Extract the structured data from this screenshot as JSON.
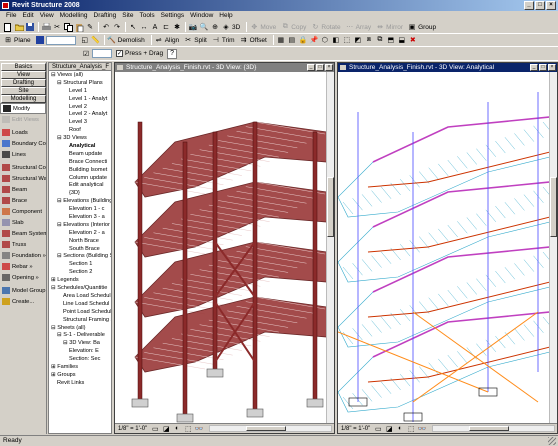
{
  "app": {
    "title": "Revit Structure 2008",
    "window_controls": [
      "_",
      "□",
      "×"
    ]
  },
  "menu": [
    "File",
    "Edit",
    "View",
    "Modelling",
    "Drafting",
    "Site",
    "Tools",
    "Settings",
    "Window",
    "Help"
  ],
  "toolbar": {
    "view_3d_label": "3D",
    "move_label": "Move",
    "copy_label": "Copy",
    "rotate_label": "Rotate",
    "array_label": "Array",
    "mirror_label": "Mirror",
    "group_label": "Group",
    "plane_label": "Plane",
    "demolish_label": "Demolish",
    "align_label": "Align",
    "split_label": "Split",
    "trim_label": "Trim",
    "offset_label": "Offset",
    "press_drag_label": "Press + Drag",
    "press_drag_checked": true
  },
  "design_bar": {
    "tabs": [
      "Basics",
      "View",
      "Drafting",
      "Site",
      "Modelling"
    ],
    "items": [
      {
        "label": "Modify",
        "icon": "arrow-icon",
        "state": "selected"
      },
      {
        "label": "Edit Views",
        "icon": "edit-icon",
        "state": "disabled"
      },
      {
        "label": "Loads",
        "icon": "loads-icon",
        "state": "normal"
      },
      {
        "label": "Boundary Cond",
        "icon": "boundary-icon",
        "state": "normal"
      },
      {
        "label": "Lines",
        "icon": "lines-icon",
        "state": "normal"
      },
      {
        "label": "Structural Colur",
        "icon": "column-icon",
        "state": "normal"
      },
      {
        "label": "Structural Wall",
        "icon": "wall-icon",
        "state": "normal"
      },
      {
        "label": "Beam",
        "icon": "beam-icon",
        "state": "normal"
      },
      {
        "label": "Brace",
        "icon": "brace-icon",
        "state": "normal"
      },
      {
        "label": "Component",
        "icon": "component-icon",
        "state": "normal"
      },
      {
        "label": "Slab",
        "icon": "slab-icon",
        "state": "normal"
      },
      {
        "label": "Beam System",
        "icon": "beam-system-icon",
        "state": "normal"
      },
      {
        "label": "Truss",
        "icon": "truss-icon",
        "state": "normal"
      },
      {
        "label": "Foundation »",
        "icon": "foundation-icon",
        "state": "normal"
      },
      {
        "label": "Rebar »",
        "icon": "rebar-icon",
        "state": "normal"
      },
      {
        "label": "Opening »",
        "icon": "opening-icon",
        "state": "normal"
      },
      {
        "label": "Model Group",
        "icon": "group-icon",
        "state": "normal"
      },
      {
        "label": "Create...",
        "icon": "create-icon",
        "state": "normal"
      }
    ]
  },
  "browser": {
    "title": "Structure_Analysis_F",
    "rows": [
      {
        "label": "⊟ Views (all)",
        "indent": 0,
        "bold": false
      },
      {
        "label": "⊟ Structural Plans",
        "indent": 1,
        "bold": false
      },
      {
        "label": "Level 1",
        "indent": 3,
        "bold": false
      },
      {
        "label": "Level 1 - Analyt",
        "indent": 3,
        "bold": false
      },
      {
        "label": "Level 2",
        "indent": 3,
        "bold": false
      },
      {
        "label": "Level 2 - Analyt",
        "indent": 3,
        "bold": false
      },
      {
        "label": "Level 3",
        "indent": 3,
        "bold": false
      },
      {
        "label": "Roof",
        "indent": 3,
        "bold": false
      },
      {
        "label": "⊟ 3D Views",
        "indent": 1,
        "bold": false
      },
      {
        "label": "Analytical",
        "indent": 3,
        "bold": true
      },
      {
        "label": "Beam update",
        "indent": 3,
        "bold": false
      },
      {
        "label": "Brace Connecti",
        "indent": 3,
        "bold": false
      },
      {
        "label": "Building Isomet",
        "indent": 3,
        "bold": false
      },
      {
        "label": "Column update",
        "indent": 3,
        "bold": false
      },
      {
        "label": "Edit analytical",
        "indent": 3,
        "bold": false
      },
      {
        "label": "{3D}",
        "indent": 3,
        "bold": false
      },
      {
        "label": "⊟ Elevations (Building",
        "indent": 1,
        "bold": false
      },
      {
        "label": "Elevation 1 - c",
        "indent": 3,
        "bold": false
      },
      {
        "label": "Elevation 3 - a",
        "indent": 3,
        "bold": false
      },
      {
        "label": "⊟ Elevations (Interior E",
        "indent": 1,
        "bold": false
      },
      {
        "label": "Elevation 2 - a",
        "indent": 3,
        "bold": false
      },
      {
        "label": "North Brace",
        "indent": 3,
        "bold": false
      },
      {
        "label": "South Brace",
        "indent": 3,
        "bold": false
      },
      {
        "label": "⊟ Sections (Building S",
        "indent": 1,
        "bold": false
      },
      {
        "label": "Section 1",
        "indent": 3,
        "bold": false
      },
      {
        "label": "Section 2",
        "indent": 3,
        "bold": false
      },
      {
        "label": "⊞ Legends",
        "indent": 0,
        "bold": false
      },
      {
        "label": "⊟ Schedules/Quantitie",
        "indent": 0,
        "bold": false
      },
      {
        "label": "Area Load Schedul",
        "indent": 2,
        "bold": false
      },
      {
        "label": "Line Load Schedul",
        "indent": 2,
        "bold": false
      },
      {
        "label": "Point Load Schedul",
        "indent": 2,
        "bold": false
      },
      {
        "label": "Structural Framing S",
        "indent": 2,
        "bold": false
      },
      {
        "label": "⊟ Sheets (all)",
        "indent": 0,
        "bold": false
      },
      {
        "label": "⊟ S-1 - Deliverable",
        "indent": 1,
        "bold": false
      },
      {
        "label": "⊟ 3D View: Ba",
        "indent": 2,
        "bold": false
      },
      {
        "label": "Elevation: E",
        "indent": 3,
        "bold": false
      },
      {
        "label": "Section: Sec",
        "indent": 3,
        "bold": false
      },
      {
        "label": "⊞ Families",
        "indent": 0,
        "bold": false
      },
      {
        "label": "⊞ Groups",
        "indent": 0,
        "bold": false
      },
      {
        "label": "Revit Links",
        "indent": 1,
        "bold": false
      }
    ]
  },
  "views": [
    {
      "title": "Structure_Analysis_Finish.rvt - 3D View: {3D}",
      "scale": "1/8\" = 1'-0\"",
      "active": false
    },
    {
      "title": "Structure_Analysis_Finish.rvt - 3D View: Analytical",
      "scale": "1/8\" = 1'-0\"",
      "active": true
    }
  ],
  "status": {
    "text": "Ready"
  },
  "colors": {
    "title_active": "#0a246a",
    "steel": "#8b2a2a",
    "analytic_beam": "#cc3300",
    "analytic_column": "#4a4aff",
    "analytic_brace": "#ff8c1a",
    "analytic_slab": "#33aacc",
    "analytic_joist": "#c040c0"
  }
}
